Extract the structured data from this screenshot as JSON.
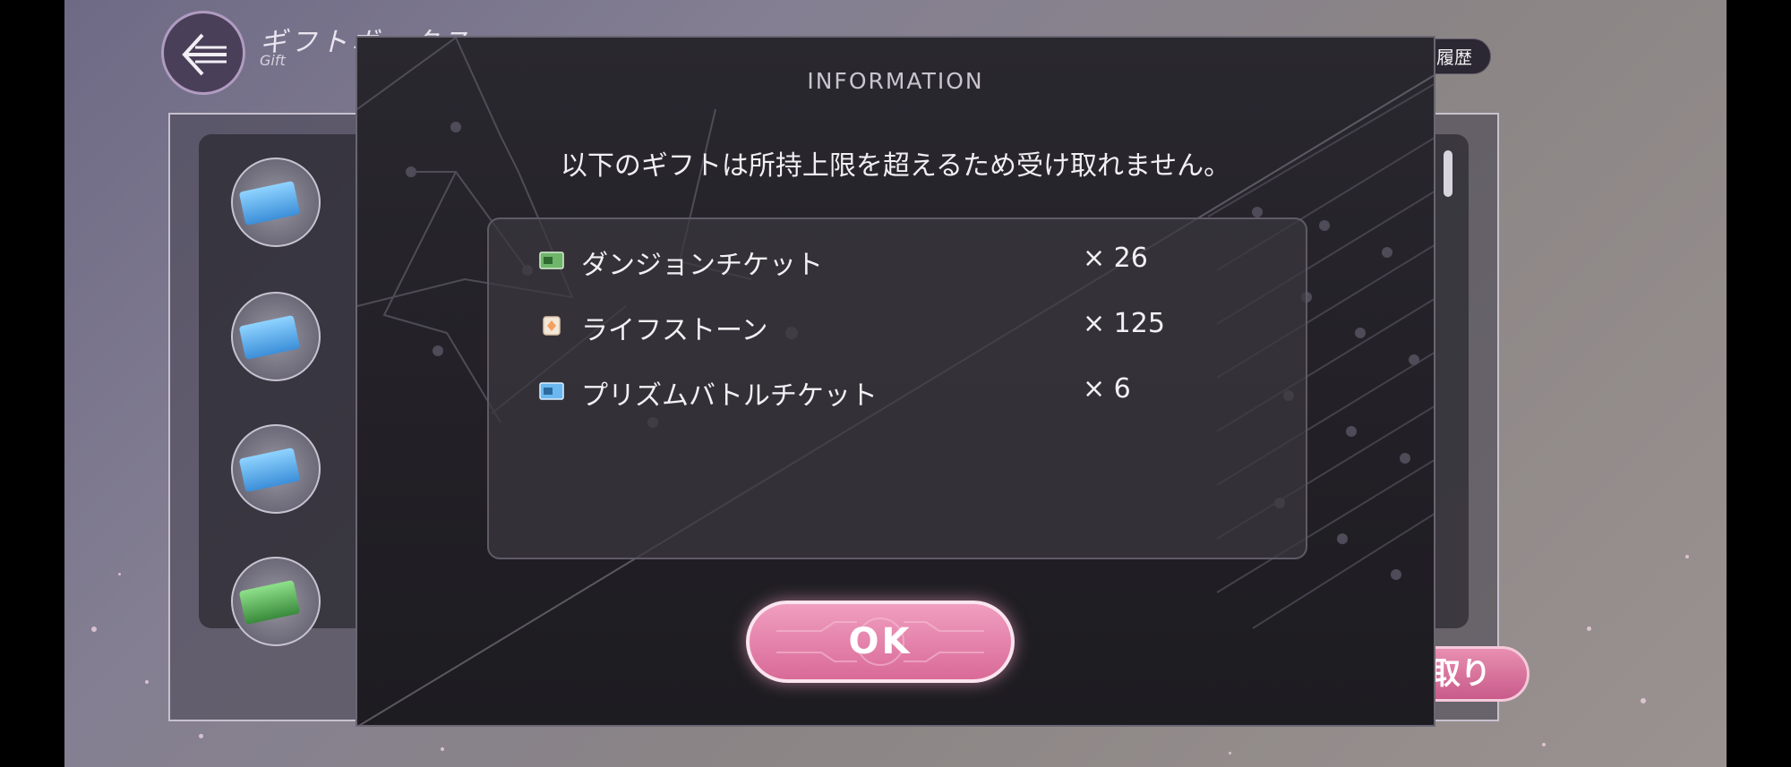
{
  "background": {
    "screen_title": "ギフトボックス",
    "screen_subtitle": "Gift",
    "history_button": "け取り履歴",
    "receive_button": "取り"
  },
  "modal": {
    "title": "INFORMATION",
    "message": "以下のギフトは所持上限を超えるため受け取れません。",
    "items": [
      {
        "name": "ダンジョンチケット",
        "quantity": "× 26",
        "icon": "green-ticket-icon",
        "color": "#6fb56a"
      },
      {
        "name": "ライフストーン",
        "quantity": "× 125",
        "icon": "life-stone-icon",
        "color": "#f0a060"
      },
      {
        "name": "プリズムバトルチケット",
        "quantity": "× 6",
        "icon": "blue-ticket-icon",
        "color": "#6ab8f0"
      }
    ],
    "ok_button": "OK"
  },
  "colors": {
    "accent_pink": "#d96a98",
    "modal_bg": "#222026"
  }
}
